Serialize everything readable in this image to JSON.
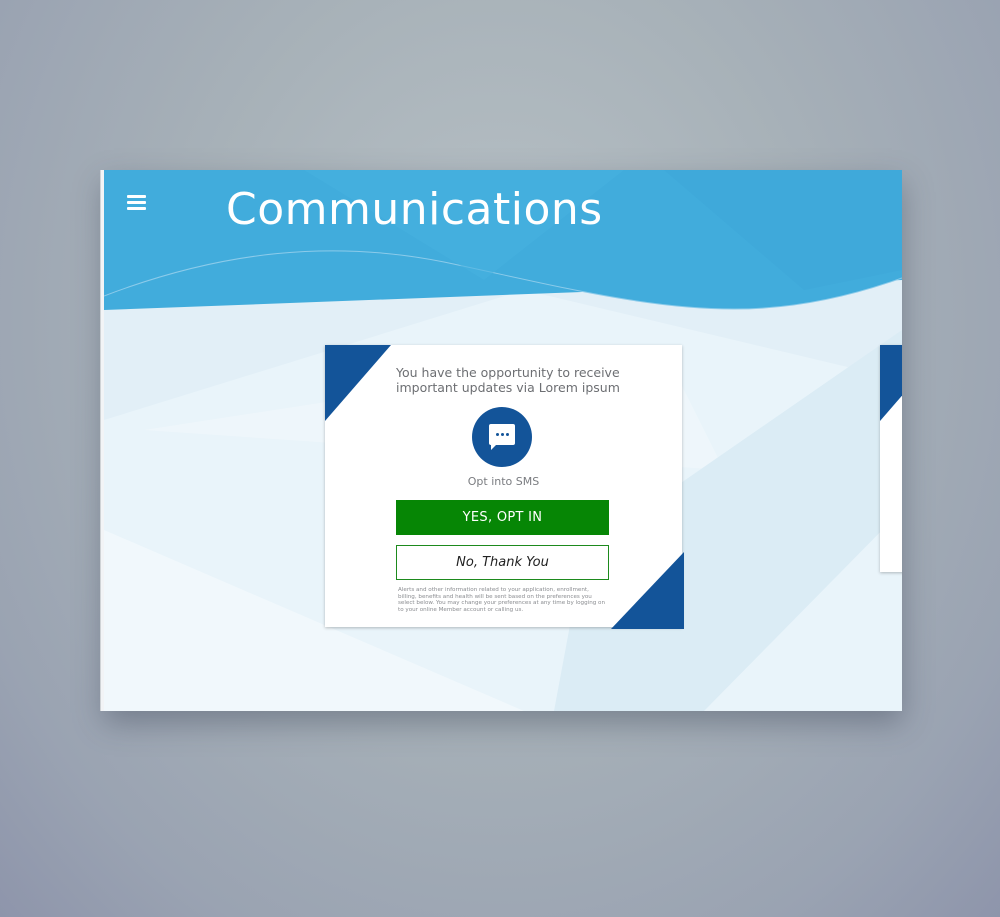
{
  "header": {
    "title": "Communications",
    "menu_icon": "hamburger-menu-icon"
  },
  "card": {
    "message": "You have the opportunity to receive important updates via Lorem ipsum",
    "icon": "chat-bubble-icon",
    "opt_label": "Opt into SMS",
    "yes_label": "YES, OPT IN",
    "no_label": "No, Thank You",
    "disclaimer": "Alerts and other information related to your application, enrollment, billing, benefits and health will be sent based on the preferences you select below.  You may change your preferences at any time by logging on to your online Member account or calling us."
  },
  "colors": {
    "header_blue": "#41acdc",
    "accent_navy": "#135499",
    "confirm_green": "#068605",
    "background": "#e3f0f7"
  }
}
